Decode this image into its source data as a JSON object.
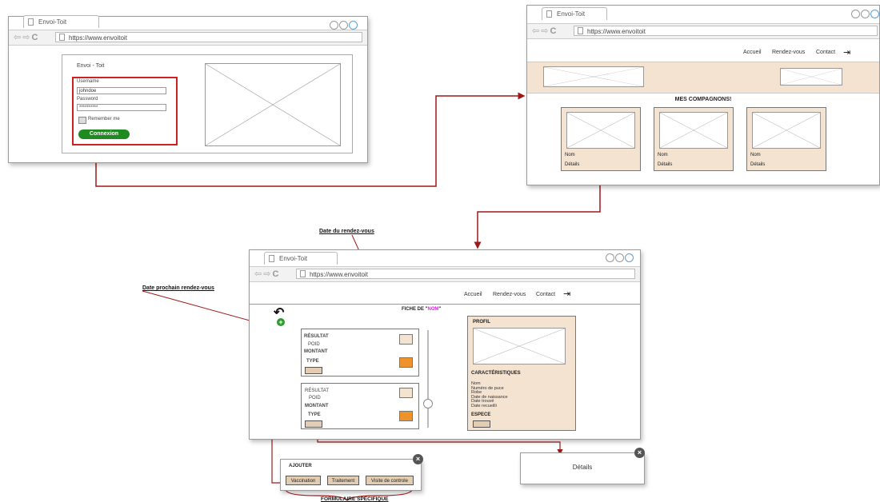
{
  "window1": {
    "tab": "Envoi-Toit",
    "url": "https://www.envoitoit",
    "form_title": "Envoi - Toit",
    "username_label": "Username",
    "username_value": "johndoe",
    "password_label": "Password",
    "password_value": "**********",
    "remember_label": "Remember me",
    "login_button": "Connexion"
  },
  "window2": {
    "tab": "Envoi-Toit",
    "url": "https://www.envoitoit",
    "nav": [
      "Accueil",
      "Rendez-vous",
      "Contact"
    ],
    "section_title": "MES COMPAGNONS!",
    "cards": [
      {
        "name": "Nom",
        "details": "Détails"
      },
      {
        "name": "Nom",
        "details": "Détails"
      },
      {
        "name": "Nom",
        "details": "Détails"
      }
    ]
  },
  "window3": {
    "tab": "Envoi-Toit",
    "url": "https://www.envoitoit",
    "nav": [
      "Accueil",
      "Rendez-vous",
      "Contact"
    ],
    "fiche_prefix": "FICHE DE \"",
    "fiche_name": "NOM",
    "fiche_suffix": "\"",
    "entry1": {
      "resultat": "RÉSULTAT",
      "poid": "POID",
      "montant": "MONTANT",
      "type": "TYPE"
    },
    "entry2": {
      "resultat": "RÉSULTAT",
      "poid": "POID",
      "montant": "MONTANT",
      "type": "TYPE"
    },
    "profil": {
      "title": "PROFIL",
      "caracteristiques": "CARACTÉRISTIQUES",
      "fields": [
        "Nom",
        "Numéro de puce",
        "Robe",
        "Date de naissance",
        "Date trouvé",
        "Date recueilli"
      ],
      "espece": "ESPECE"
    }
  },
  "popup_ajouter": {
    "title": "AJOUTER",
    "buttons": [
      "Vaccination",
      "Traitement",
      "Visite de controle"
    ]
  },
  "popup_details": {
    "label": "Détails"
  },
  "annotations": {
    "date_rdv": "Date du rendez-vous",
    "date_prochain": "Date prochain rendez-vous",
    "formulaire": "FORMULAIRE SPÉCIFIQUE"
  },
  "colors": {
    "connector": "#a01818",
    "accent_green": "#1f8a1f",
    "card_beige": "#f3e3d0",
    "accent_orange": "#f0922a",
    "highlight_name": "#e020e0"
  }
}
